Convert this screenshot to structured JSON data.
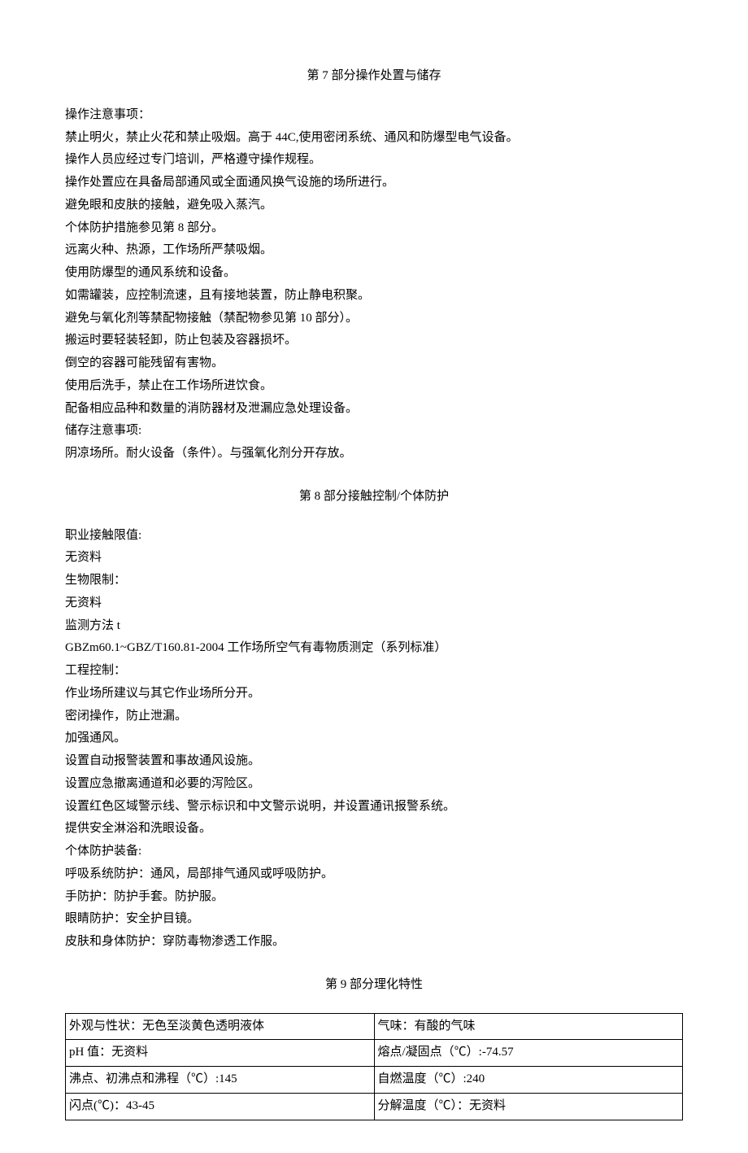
{
  "section7": {
    "title": "第 7 部分操作处置与储存",
    "lines": [
      "操作注意事项：",
      "禁止明火，禁止火花和禁止吸烟。高于 44C,使用密闭系统、通风和防爆型电气设备。",
      "操作人员应经过专门培训，严格遵守操作规程。",
      "操作处置应在具备局部通风或全面通风换气设施的场所进行。",
      "避免眼和皮肤的接触，避免吸入蒸汽。",
      "个体防护措施参见第 8 部分。",
      "远离火种、热源，工作场所严禁吸烟。",
      "使用防爆型的通风系统和设备。",
      "如需罐装，应控制流速，且有接地装置，防止静电积聚。",
      "避免与氧化剂等禁配物接触（禁配物参见第 10 部分）。",
      "搬运时要轻装轻卸，防止包装及容器损坏。",
      "倒空的容器可能残留有害物。",
      "使用后洗手，禁止在工作场所进饮食。",
      "配备相应品种和数量的消防器材及泄漏应急处理设备。",
      "储存注意事项:",
      "阴凉场所。耐火设备（条件）。与强氧化剂分开存放。"
    ]
  },
  "section8": {
    "title": "第 8 部分接触控制/个体防护",
    "lines": [
      "职业接触限值:",
      "无资料",
      "生物限制：",
      "无资料",
      "监测方法 t",
      "GBZm60.1~GBZ/T160.81-2004 工作场所空气有毒物质测定（系列标准）",
      "工程控制：",
      "作业场所建议与其它作业场所分开。",
      "密闭操作，防止泄漏。",
      "加强通风。",
      "设置自动报警装置和事故通风设施。",
      "设置应急撤离通道和必要的泻险区。",
      "设置红色区域警示线、警示标识和中文警示说明，并设置通讯报警系统。",
      "提供安全淋浴和洗眼设备。",
      "个体防护装备:",
      "呼吸系统防护：通风，局部排气通风或呼吸防护。",
      "手防护：防护手套。防护服。",
      "眼睛防护：安全护目镜。",
      "皮肤和身体防护：穿防毒物渗透工作服。"
    ]
  },
  "section9": {
    "title": "第 9 部分理化特性",
    "rows": [
      {
        "left": "外观与性状：无色至淡黄色透明液体",
        "right": "气味：有酸的气味"
      },
      {
        "left": "pH 值：无资料",
        "right": "熔点/凝固点（℃）:-74.57"
      },
      {
        "left": "沸点、初沸点和沸程（℃）:145",
        "right": "自燃温度（℃）:240"
      },
      {
        "left": "闪点(℃)：43-45",
        "right": "分解温度（℃）：无资料"
      }
    ]
  }
}
